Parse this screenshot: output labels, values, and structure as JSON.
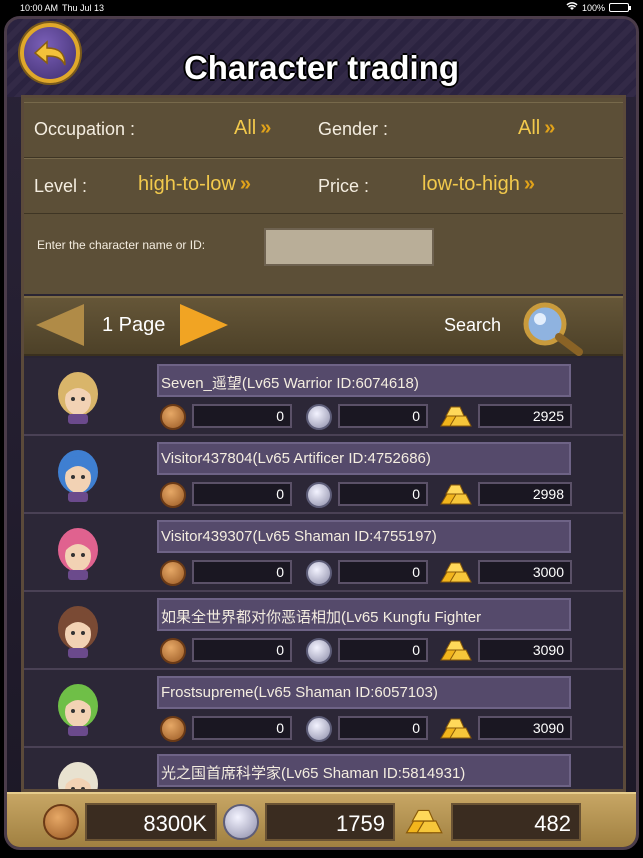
{
  "status": {
    "time": "10:00 AM",
    "date": "Thu Jul 13",
    "battery": "100%",
    "battery_level": 1.0
  },
  "header": {
    "title": "Character trading",
    "back_icon": "back-arrow-icon"
  },
  "filters": {
    "occupation_label": "Occupation :",
    "occupation_value": "All",
    "gender_label": "Gender :",
    "gender_value": "All",
    "level_label": "Level :",
    "level_value": "high-to-low",
    "price_label": "Price :",
    "price_value": "low-to-high",
    "search_prompt": "Enter the character name or ID:",
    "search_value": "",
    "chevron": "»"
  },
  "pager": {
    "page_label": "1 Page",
    "search_label": "Search"
  },
  "rows": [
    {
      "name": "Seven_遥望(Lv65 Warrior ID:6074618)",
      "bronze": "0",
      "silver": "0",
      "gold": "2925",
      "hair": "#d9b56a"
    },
    {
      "name": "Visitor437804(Lv65 Artificer ID:4752686)",
      "bronze": "0",
      "silver": "0",
      "gold": "2998",
      "hair": "#3f7fd1"
    },
    {
      "name": "Visitor439307(Lv65 Shaman ID:4755197)",
      "bronze": "0",
      "silver": "0",
      "gold": "3000",
      "hair": "#e0628f"
    },
    {
      "name": "如果全世界都对你恶语相加(Lv65 Kungfu Fighter",
      "bronze": "0",
      "silver": "0",
      "gold": "3090",
      "hair": "#7a4a34"
    },
    {
      "name": "Frostsupreme(Lv65 Shaman ID:6057103)",
      "bronze": "0",
      "silver": "0",
      "gold": "3090",
      "hair": "#6fbf47"
    },
    {
      "name": "光之国首席科学家(Lv65 Shaman ID:5814931)",
      "bronze": "",
      "silver": "",
      "gold": "",
      "hair": "#e8e2d0"
    }
  ],
  "wallet": {
    "bronze": "8300K",
    "silver": "1759",
    "gold": "482"
  }
}
